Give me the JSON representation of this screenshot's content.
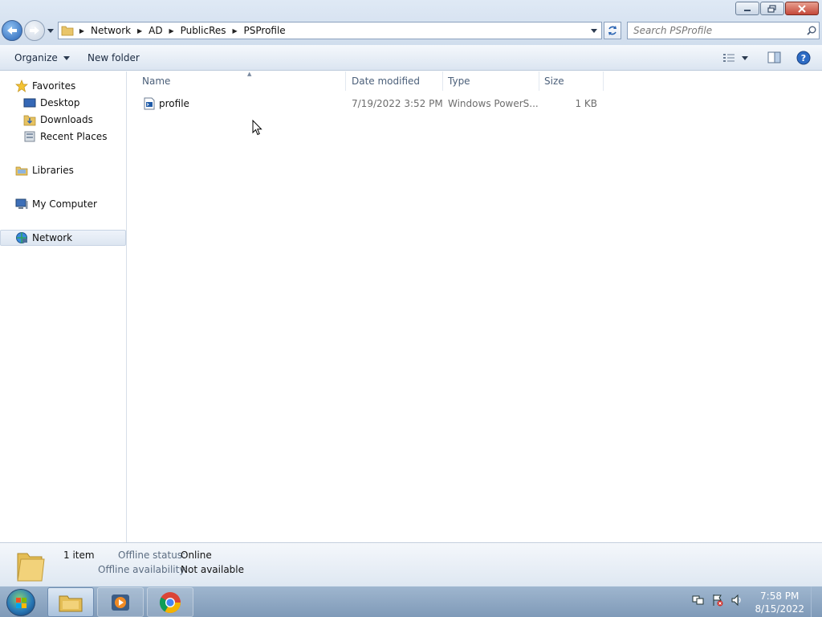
{
  "window": {
    "minimize_icon": "minimize-icon",
    "restore_icon": "restore-icon",
    "close_icon": "close-icon"
  },
  "address_bar": {
    "breadcrumbs": [
      "Network",
      "AD",
      "PublicRes",
      "PSProfile"
    ]
  },
  "search": {
    "placeholder": "Search PSProfile"
  },
  "command_bar": {
    "organize_label": "Organize",
    "new_folder_label": "New folder"
  },
  "nav_pane": {
    "favorites": "Favorites",
    "desktop": "Desktop",
    "downloads": "Downloads",
    "recent_places": "Recent Places",
    "libraries": "Libraries",
    "my_computer": "My Computer",
    "network": "Network"
  },
  "file_list": {
    "columns": [
      "Name",
      "Date modified",
      "Type",
      "Size"
    ],
    "rows": [
      {
        "name": "profile",
        "date_modified": "7/19/2022 3:52 PM",
        "type": "Windows PowerS...",
        "size": "1 KB"
      }
    ]
  },
  "details_pane": {
    "count": "1 item",
    "offline_status_label": "Offline status:",
    "offline_status_value": "Online",
    "offline_availability_label": "Offline availability:",
    "offline_availability_value": "Not available"
  },
  "taskbar": {
    "time": "7:58 PM",
    "date": "8/15/2022"
  },
  "colors": {
    "accent": "#2763b6",
    "selection": "#dde6f1"
  }
}
